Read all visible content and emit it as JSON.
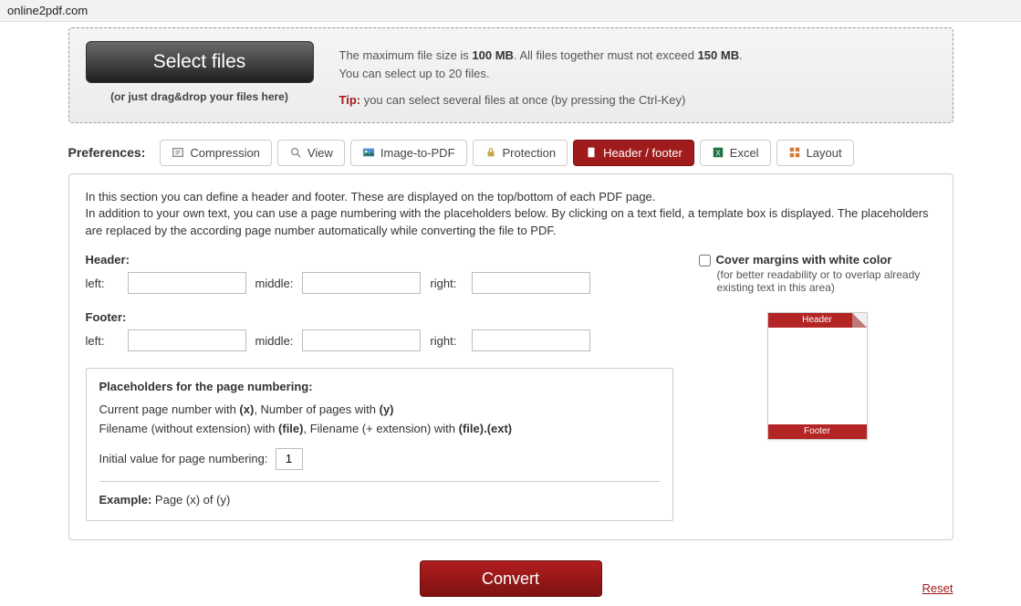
{
  "address_bar": "online2pdf.com",
  "upload": {
    "select_button": "Select files",
    "drag_hint": "(or just drag&drop your files here)",
    "limit_pre": "The maximum file size is ",
    "limit_b1": "100 MB",
    "limit_mid": ". All files together must not exceed ",
    "limit_b2": "150 MB",
    "limit_post": ".",
    "line2": "You can select up to 20 files.",
    "tip_label": "Tip:",
    "tip_text": " you can select several files at once (by pressing the Ctrl-Key)"
  },
  "prefs_label": "Preferences:",
  "tabs": {
    "compression": "Compression",
    "view": "View",
    "image": "Image-to-PDF",
    "protection": "Protection",
    "header": "Header / footer",
    "excel": "Excel",
    "layout": "Layout"
  },
  "panel": {
    "desc_l1": "In this section you can define a header and footer. These are displayed on the top/bottom of each PDF page.",
    "desc_l2": "In addition to your own text, you can use a page numbering with the placeholders below. By clicking on a text field, a template box is displayed. The placeholders are replaced by the according page number automatically while converting the file to PDF.",
    "header_label": "Header:",
    "footer_label": "Footer:",
    "left_label": "left:",
    "middle_label": "middle:",
    "right_label": "right:",
    "cover_label": "Cover margins with white color",
    "cover_sub": "(for better readability or to overlap already existing text in this area)",
    "placeholders_title": "Placeholders for the page numbering:",
    "ph_line1_a": "Current page number with ",
    "ph_line1_b": "(x)",
    "ph_line1_c": ", Number of pages with ",
    "ph_line1_d": "(y)",
    "ph_line2_a": "Filename (without extension) with ",
    "ph_line2_b": "(file)",
    "ph_line2_c": ", Filename (+ extension) with ",
    "ph_line2_d": "(file).(ext)",
    "init_label": "Initial value for page numbering:",
    "init_value": "1",
    "example_label": "Example:",
    "example_text": " Page (x) of (y)",
    "preview_header": "Header",
    "preview_footer": "Footer"
  },
  "convert_label": "Convert",
  "reset_label": "Reset"
}
